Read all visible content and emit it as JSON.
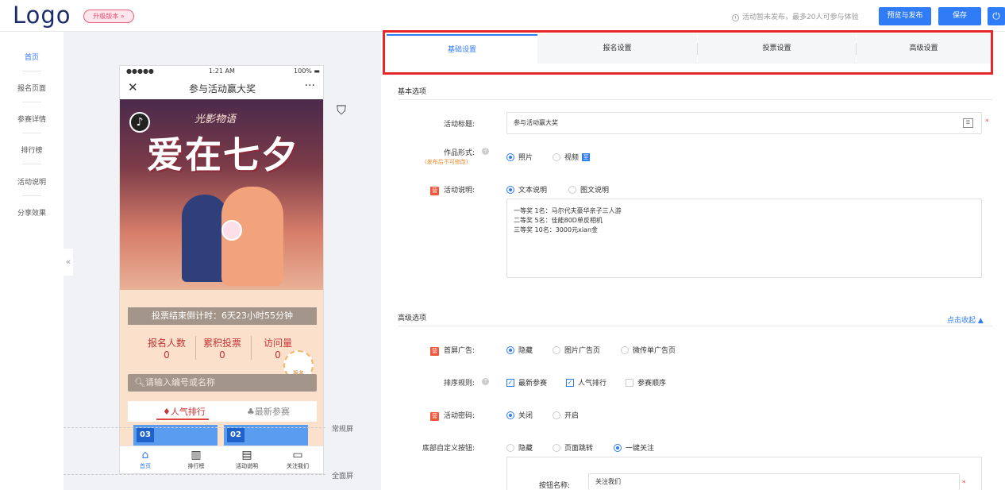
{
  "header": {
    "logo": "Logo",
    "upgrade": "升级版本 »",
    "notice": "活动暂未发布，最多20人可参与体验",
    "preview_btn": "预览与发布",
    "save_btn": "保存",
    "power_icon": "power-icon"
  },
  "leftnav": [
    "首页",
    "报名页面",
    "参赛详情",
    "排行榜",
    "活动说明",
    "分享效果"
  ],
  "phone": {
    "dots": "●●●●●",
    "time": "1:21 AM",
    "battery": "100%",
    "title": "参与活动赢大奖",
    "banner_sub": "光影物语",
    "banner_main": "爱在七夕",
    "countdown": "投票结束倒计时：6天23小时55分钟",
    "stats": [
      {
        "label": "报名人数",
        "value": "0"
      },
      {
        "label": "累积投票",
        "value": "0"
      },
      {
        "label": "访问量",
        "value": "0"
      }
    ],
    "signup_badge": "报名",
    "search_placeholder": "请输入编号或名称",
    "rank_tabs": [
      "人气排行",
      "最新参赛"
    ],
    "cards": [
      "03",
      "02"
    ],
    "tabbar": [
      {
        "icon": "home-icon",
        "label": "首页"
      },
      {
        "icon": "bar-chart-icon",
        "label": "排行榜"
      },
      {
        "icon": "document-icon",
        "label": "活动说明"
      },
      {
        "icon": "follow-icon",
        "label": "关注我们"
      }
    ]
  },
  "screen_labels": {
    "normal": "常规屏",
    "full": "全面屏"
  },
  "tabs": [
    "基础设置",
    "报名设置",
    "投票设置",
    "高级设置"
  ],
  "basic": {
    "section": "基本选项",
    "title_label": "活动标题:",
    "title_value": "参与活动赢大奖",
    "form_label": "作品形式:",
    "form_note": "(发布后不可修改)",
    "form_options": [
      "照片",
      "视频"
    ],
    "form_badge": "至",
    "desc_label": "活动说明:",
    "desc_options": [
      "文本说明",
      "图文说明"
    ],
    "desc_text": "一等奖 1名：马尔代夫豪华亲子三人游\n二等奖 5名：佳能80D单反相机\n三等奖 10名：3000元xian金"
  },
  "advanced": {
    "section": "高级选项",
    "collapse": "点击收起 ▲",
    "ad_label": "首屏广告:",
    "ad_options": [
      "隐藏",
      "图片广告页",
      "微传单广告页"
    ],
    "sort_label": "排序规则:",
    "sort_options": [
      "最新参赛",
      "人气排行",
      "参赛顺序"
    ],
    "pwd_label": "活动密码:",
    "pwd_options": [
      "关闭",
      "开启"
    ],
    "bottom_label": "底部自定义按钮:",
    "bottom_options": [
      "隐藏",
      "页面跳转",
      "一键关注"
    ],
    "btn_name_label": "按钮名称:",
    "btn_name_value": "关注我们"
  },
  "colors": {
    "accent": "#2f7cf6",
    "highlight_box": "#e8272a",
    "warning": "#f08a24"
  }
}
